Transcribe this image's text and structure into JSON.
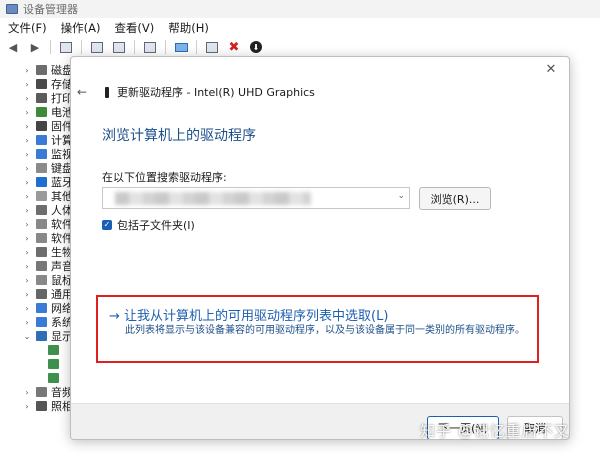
{
  "window": {
    "title": "设备管理器"
  },
  "menu": [
    "文件(F)",
    "操作(A)",
    "查看(V)",
    "帮助(H)"
  ],
  "tree": {
    "items": [
      {
        "label": "磁盘",
        "expanded": false
      },
      {
        "label": "存储",
        "expanded": false
      },
      {
        "label": "打印",
        "expanded": false
      },
      {
        "label": "电池",
        "expanded": false
      },
      {
        "label": "固件",
        "expanded": false
      },
      {
        "label": "计算",
        "expanded": false
      },
      {
        "label": "监视",
        "expanded": false
      },
      {
        "label": "键盘",
        "expanded": false
      },
      {
        "label": "蓝牙",
        "expanded": false
      },
      {
        "label": "其他",
        "expanded": false
      },
      {
        "label": "人体",
        "expanded": false
      },
      {
        "label": "软件",
        "expanded": false
      },
      {
        "label": "软件",
        "expanded": false
      },
      {
        "label": "生物",
        "expanded": false
      },
      {
        "label": "声音",
        "expanded": false
      },
      {
        "label": "鼠标",
        "expanded": false
      },
      {
        "label": "通用",
        "expanded": false
      },
      {
        "label": "网络",
        "expanded": false
      },
      {
        "label": "系统",
        "expanded": false
      },
      {
        "label": "显示",
        "expanded": true
      },
      {
        "label": "",
        "child": true
      },
      {
        "label": "",
        "child": true
      },
      {
        "label": "",
        "child": true
      },
      {
        "label": "音频",
        "expanded": false
      },
      {
        "label": "照相",
        "expanded": false
      }
    ]
  },
  "dialog": {
    "title": "更新驱动程序 - Intel(R) UHD Graphics",
    "heading": "浏览计算机上的驱动程序",
    "search_label": "在以下位置搜索驱动程序:",
    "browse_label": "浏览(R)...",
    "include_subfolders": "包括子文件夹(I)",
    "include_subfolders_checked": true,
    "pick_link": "→ 让我从计算机上的可用驱动程序列表中选取(L)",
    "pick_desc": "此列表将显示与该设备兼容的可用驱动程序，以及与该设备属于同一类别的所有驱动程序。",
    "next_label": "下一页(N)",
    "cancel_label": "取消"
  },
  "watermark": "知乎 @记忆重启不叉",
  "colors": {
    "heading": "#1d4f8a",
    "link": "#1d5fb0",
    "highlight_box": "#e02020",
    "accent": "#1a5fb4"
  }
}
